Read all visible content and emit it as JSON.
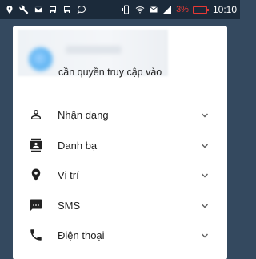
{
  "status_bar": {
    "time": "10:10",
    "battery_percent": "3%",
    "battery_level": 0.03,
    "left_icons": [
      "location-pin-icon",
      "wrench-icon",
      "mail-icon",
      "bus-icon",
      "bus-icon",
      "chat-bubble-icon"
    ],
    "right_icons": [
      "phone-vibrate-icon",
      "wifi-icon",
      "mail-icon",
      "signal-icon",
      "battery-icon"
    ]
  },
  "dialog": {
    "message": "cần quyền truy cập vào",
    "permissions": [
      {
        "label": "Nhận dạng",
        "icon": "person-icon"
      },
      {
        "label": "Danh bạ",
        "icon": "contacts-icon"
      },
      {
        "label": "Vị trí",
        "icon": "location-pin-icon"
      },
      {
        "label": "SMS",
        "icon": "message-icon"
      },
      {
        "label": "Điện thoại",
        "icon": "phone-icon"
      }
    ]
  },
  "colors": {
    "status_bar_bg": "#1b2a3a",
    "backdrop": "#34495f",
    "battery": "#e53935",
    "text": "#212121",
    "icon": "#212121",
    "chevron": "#616161"
  }
}
